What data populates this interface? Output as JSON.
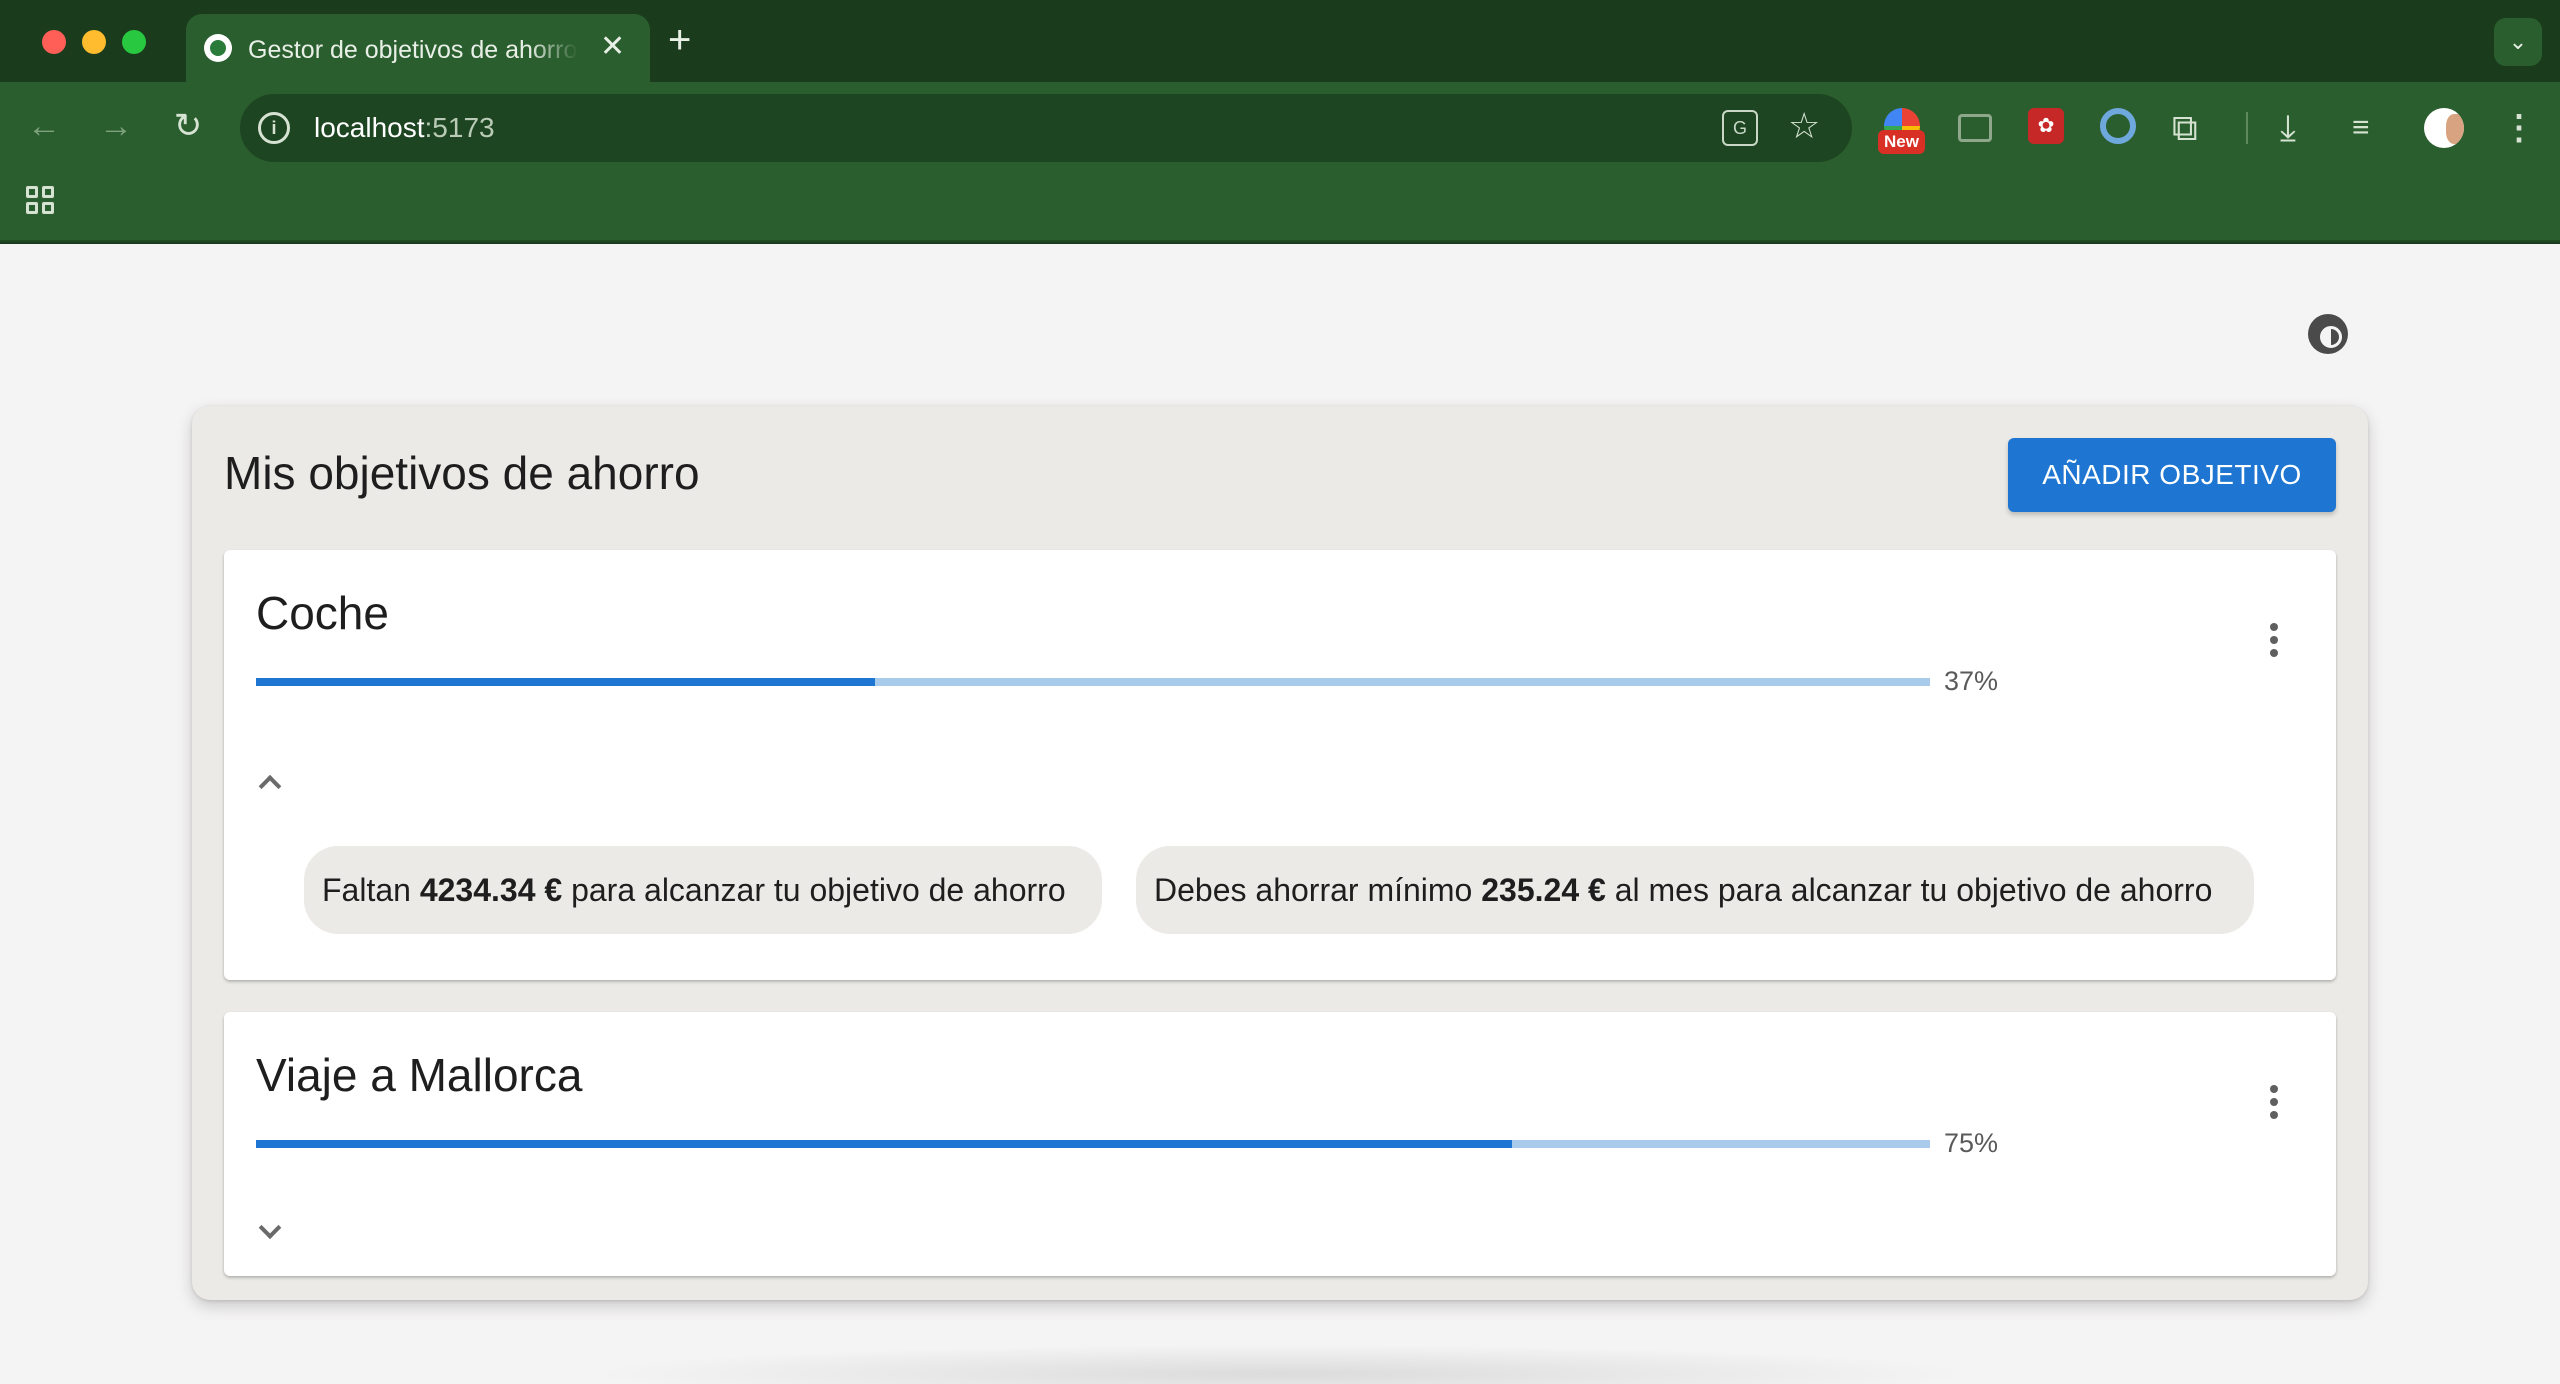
{
  "browser": {
    "tab_title": "Gestor de objetivos de ahorro",
    "tab_close": "✕",
    "new_tab": "+",
    "url_host": "localhost",
    "url_port": ":5173",
    "extension_badge": "New",
    "icons": [
      "back-arrow-icon",
      "forward-arrow-icon",
      "reload-icon",
      "info-icon",
      "translate-icon",
      "star-icon",
      "extensions-icon",
      "download-icon",
      "media-icon",
      "kebab-icon",
      "apps-grid-icon",
      "chevron-down-icon"
    ]
  },
  "page": {
    "title": "Mis objetivos de ahorro",
    "add_button": "AÑADIR OBJETIVO",
    "theme_icon": "brightness-icon",
    "goals": [
      {
        "name": "Coche",
        "progress": 37,
        "progress_label": "37%",
        "expanded": true,
        "info_chips": [
          {
            "before": "Faltan ",
            "amount": "4234.34 €",
            "after": " para alcanzar tu objetivo de ahorro"
          },
          {
            "before": "Debes ahorrar mínimo ",
            "amount": "235.24 €",
            "after": " al mes para alcanzar tu objetivo de ahorro"
          }
        ]
      },
      {
        "name": "Viaje a Mallorca",
        "progress": 75,
        "progress_label": "75%",
        "expanded": false,
        "info_chips": []
      }
    ]
  },
  "colors": {
    "chrome_dark": "#1a3b1c",
    "chrome_toolbar": "#2a5e2e",
    "accent": "#1e76d2",
    "progress_track": "#a9cbeb",
    "panel_bg": "#ebeae6",
    "page_bg": "#f5f4f4"
  }
}
